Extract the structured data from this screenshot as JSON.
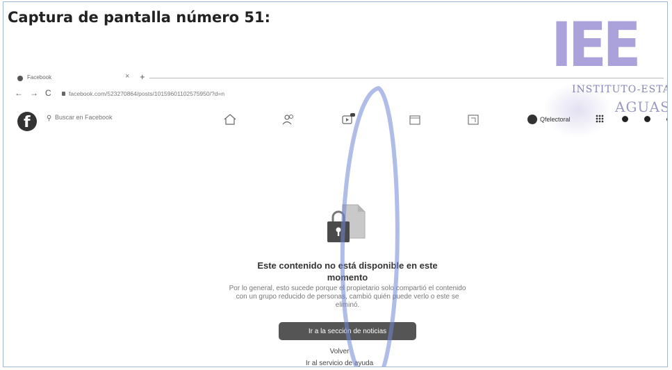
{
  "document": {
    "title": "Captura de pantalla número 51:"
  },
  "stamp": {
    "letters": "IEE",
    "line1": "INSTITUTO-ESTATAL-E",
    "line2": "AGUAS"
  },
  "browser": {
    "tab_title": "Facebook",
    "tab_close": "×",
    "tab_new": "+",
    "back": "←",
    "forward": "→",
    "reload": "C",
    "url": "facebook.com/523270864/posts/10159601102575950/?d=n"
  },
  "facebook_header": {
    "logo": "f",
    "search_placeholder": "Buscar en Facebook",
    "profile_name": "Qfelectoral"
  },
  "icons": {
    "home": "home-icon",
    "friends": "friends-icon",
    "watch": "watch-icon",
    "marketplace": "marketplace-icon",
    "gaming": "gaming-icon",
    "menu": "grid-menu-icon",
    "messenger": "messenger-icon",
    "notifications": "bell-icon",
    "account": "account-chevron-icon",
    "content_unavailable": "locked-document-icon"
  },
  "main": {
    "title": "Este contenido no está disponible en este momento",
    "description": "Por lo general, esto sucede porque el propietario solo compartió el contenido con un grupo reducido de personas, cambió quién puede verlo o este se eliminó.",
    "news_button": "Ir a la sección de noticias",
    "back_link": "Volver",
    "help_link": "Ir al servicio de ayuda"
  },
  "colors": {
    "stamp": "#7c6cc7",
    "pen": "#6f86d6",
    "button": "#555555"
  }
}
